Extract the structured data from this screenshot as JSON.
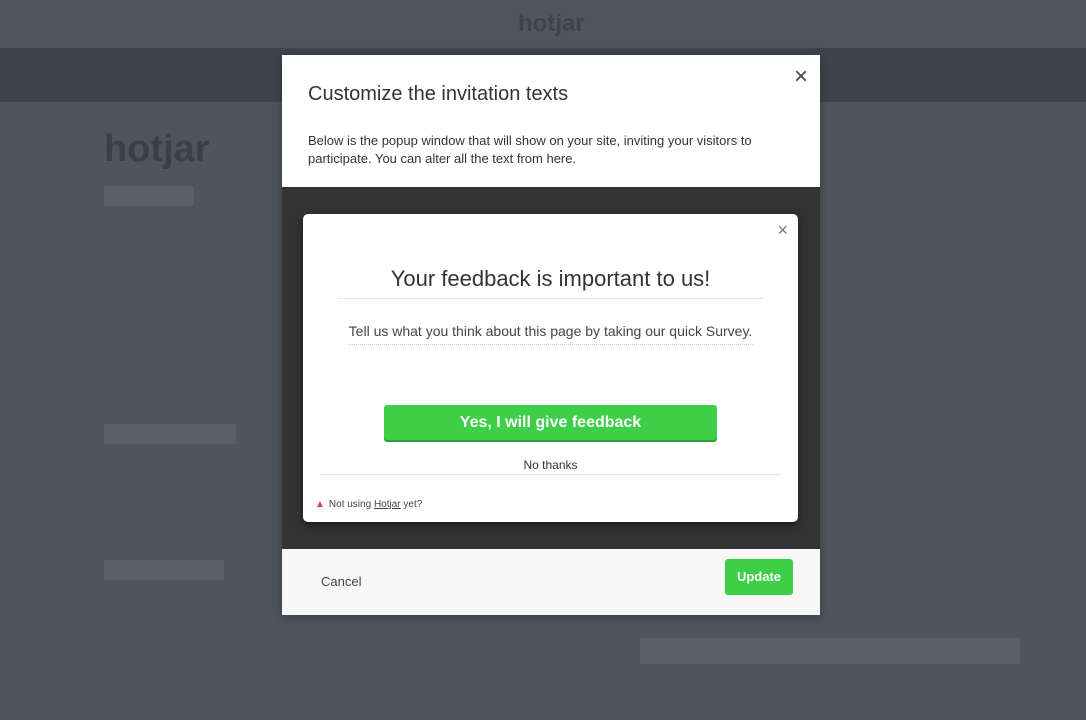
{
  "background": {
    "logo": "hotjar"
  },
  "modal": {
    "title": "Customize the invitation texts",
    "description": "Below is the popup window that will show on your site, inviting your visitors to participate. You can alter all the text from here.",
    "close_icon": "×",
    "cancel_label": "Cancel",
    "update_label": "Update"
  },
  "popup": {
    "close_icon": "×",
    "title": "Your feedback is important to us!",
    "text": "Tell us what you think about this page by taking our quick Survey.",
    "yes_label": "Yes, I will give feedback",
    "no_label": "No thanks",
    "note_prefix": "Not using",
    "note_link": "Hotjar",
    "note_suffix": "yet?"
  },
  "colors": {
    "accent": "#3ccf47",
    "flame": "#e8394a"
  }
}
